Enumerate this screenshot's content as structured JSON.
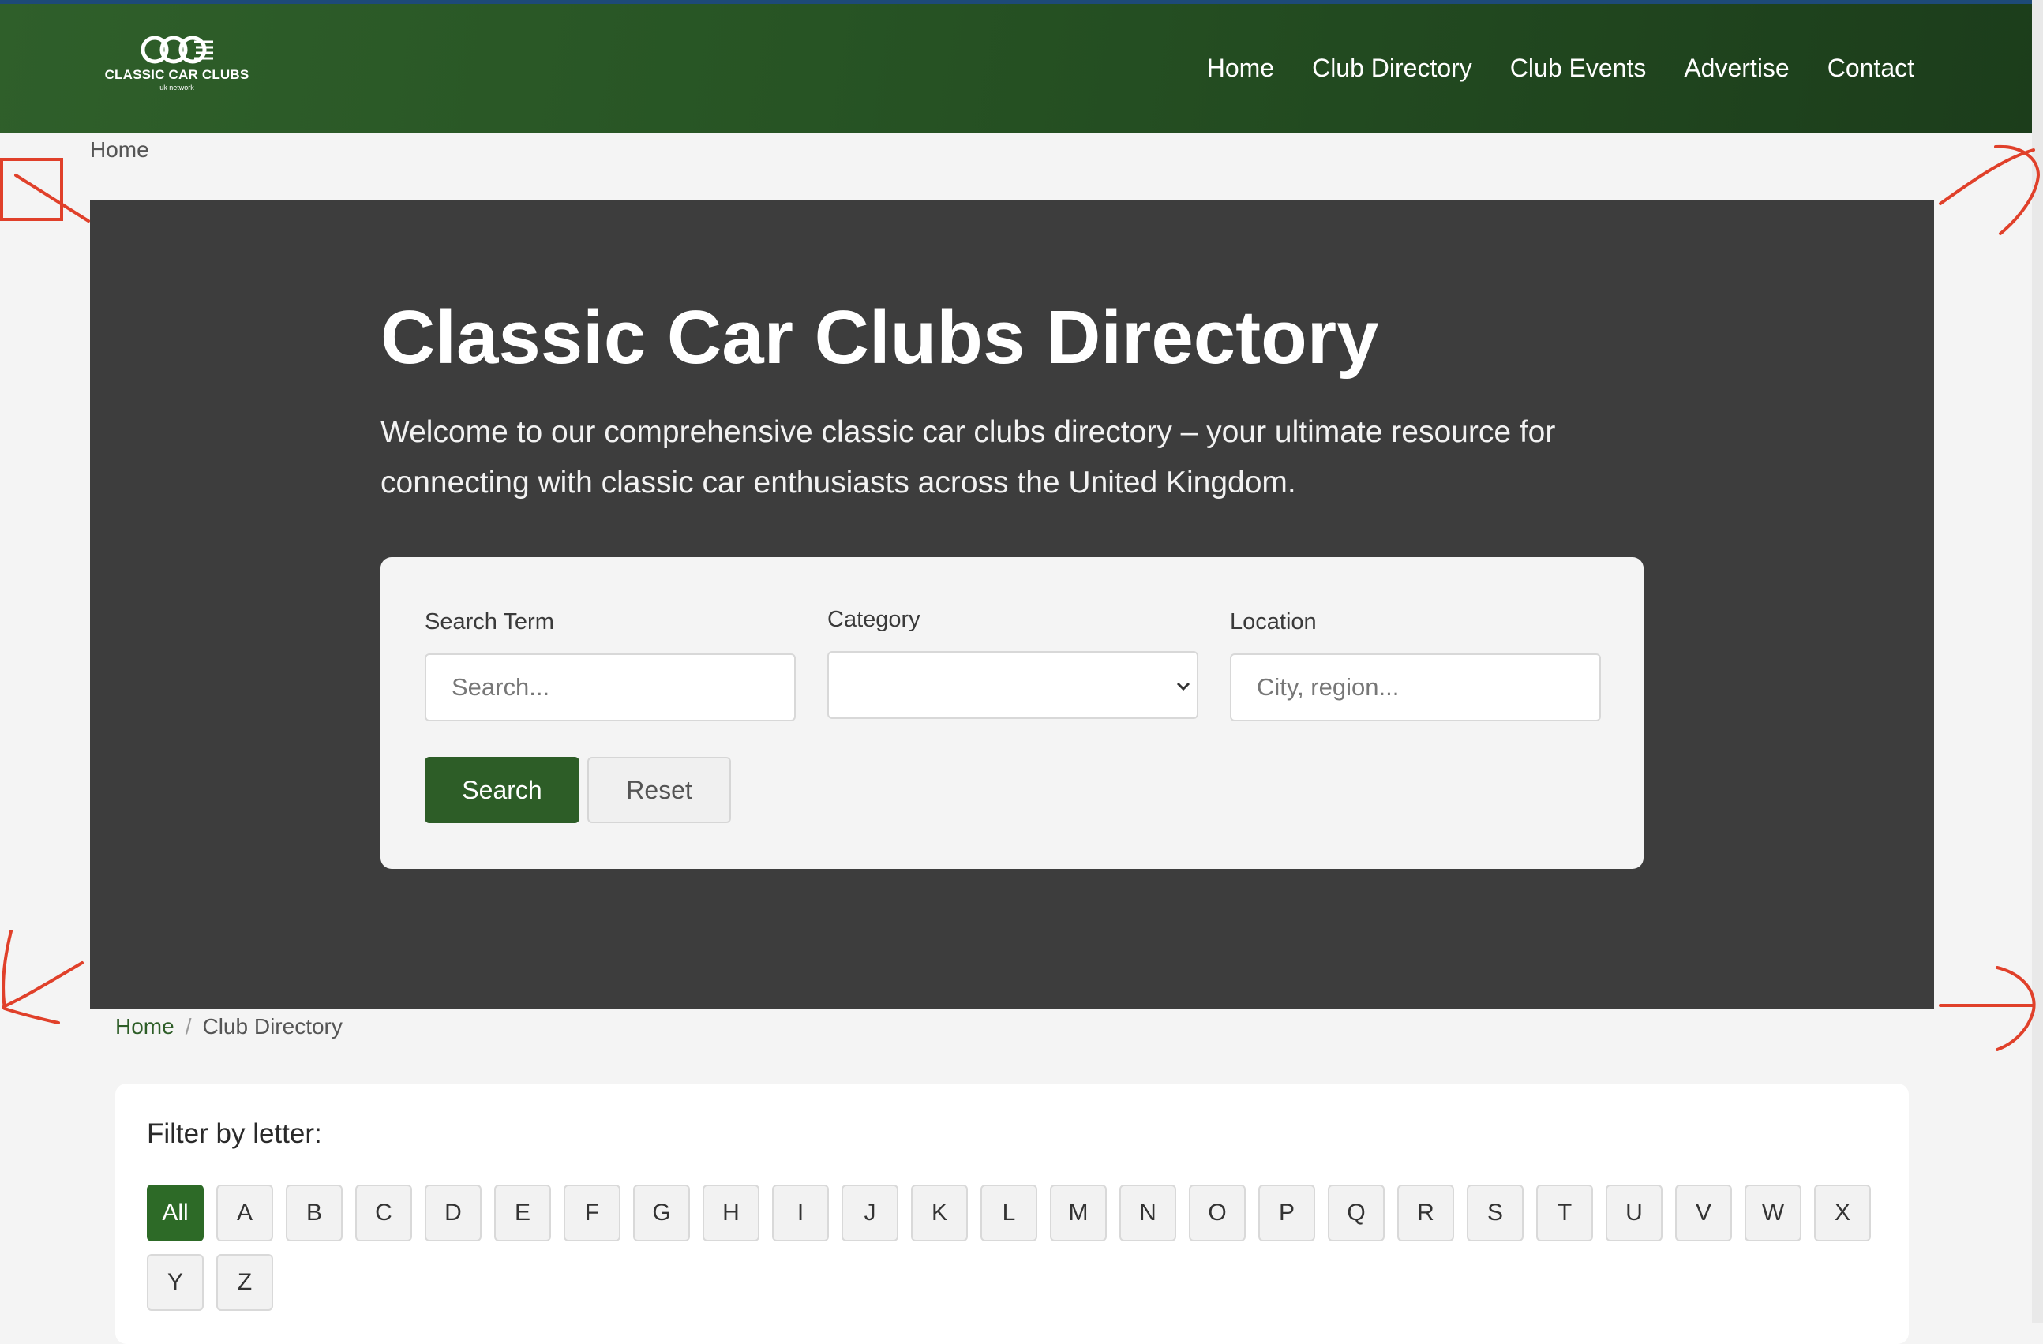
{
  "header": {
    "logo": {
      "title": "CLASSIC CAR CLUBS",
      "subtitle": "uk network"
    },
    "nav": [
      "Home",
      "Club Directory",
      "Club Events",
      "Advertise",
      "Contact"
    ]
  },
  "top_breadcrumb": "Home",
  "hero": {
    "title": "Classic Car Clubs Directory",
    "intro": "Welcome to our comprehensive classic car clubs directory – your ultimate resource for connecting with classic car enthusiasts across the United Kingdom."
  },
  "search": {
    "term_label": "Search Term",
    "term_placeholder": "Search...",
    "category_label": "Category",
    "category_value": "",
    "location_label": "Location",
    "location_placeholder": "City, region...",
    "search_button": "Search",
    "reset_button": "Reset"
  },
  "breadcrumb": {
    "home": "Home",
    "separator": "/",
    "current": "Club Directory"
  },
  "filter": {
    "title": "Filter by letter:",
    "letters": [
      "All",
      "A",
      "B",
      "C",
      "D",
      "E",
      "F",
      "G",
      "H",
      "I",
      "J",
      "K",
      "L",
      "M",
      "N",
      "O",
      "P",
      "Q",
      "R",
      "S",
      "T",
      "U",
      "V",
      "W",
      "X",
      "Y",
      "Z"
    ],
    "active": "All"
  },
  "colors": {
    "header_green": "#2f5f2a",
    "accent_green": "#2d5d27",
    "hero_bg": "#3d3d3d",
    "annotation_red": "#e0402a"
  }
}
